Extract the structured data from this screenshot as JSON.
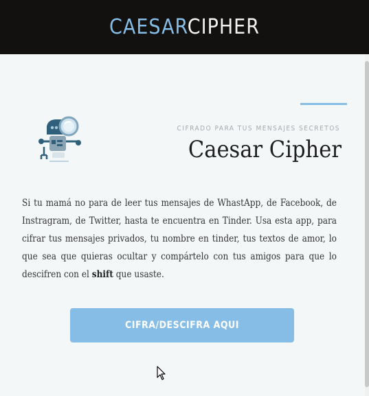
{
  "header": {
    "brand_part1": "Caesar",
    "brand_part2": "Cipher"
  },
  "hero": {
    "logo_icon": "robot-magnifier-icon",
    "tagline": "Cifrado para tus mensajes secretos",
    "title": "Caesar Cipher"
  },
  "description": {
    "text_before": "Si tu mamá no para de leer tus mensajes de WhastApp, de Facebook, de Instragram, de Twitter, hasta te encuentra en Tinder. Usa esta app, para cifrar tus mensajes privados, tu nombre en tinder, tus textos de amor, lo que sea que quieras ocultar y compártelo con tus amigos para que lo descifren con el ",
    "bold": "shift",
    "text_after": " que usaste."
  },
  "cta": {
    "label": "Cifra/Descifra aqui"
  },
  "colors": {
    "accent": "#86bde6",
    "header_bg": "#121110",
    "page_bg": "#f4f7f8",
    "robot_dark": "#2f5f7a"
  }
}
